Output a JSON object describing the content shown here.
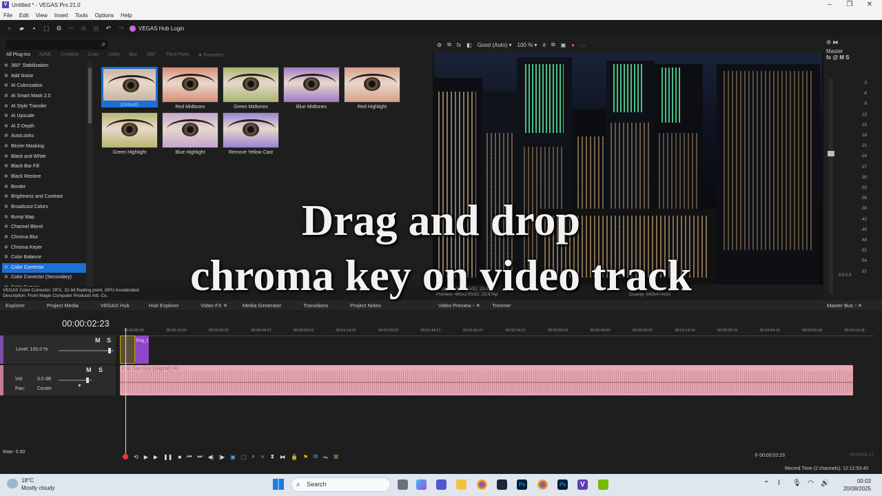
{
  "window": {
    "title": "Untitled * - VEGAS Pro 21.0"
  },
  "menu": [
    "File",
    "Edit",
    "View",
    "Insert",
    "Tools",
    "Options",
    "Help"
  ],
  "toolbar": {
    "hub_login": "VEGAS Hub Login"
  },
  "fx": {
    "tabs": [
      "All Plug-ins",
      "AI/ML",
      "Creative",
      "Color",
      "Utility",
      "Blur",
      "360°",
      "Third Party",
      "Favorites"
    ],
    "plugins": [
      "360° Stabilization",
      "Add Noise",
      "AI Colorization",
      "AI Smart Mask 2.0",
      "AI Style Transfer",
      "AI Upscale",
      "AI Z-Depth",
      "AutoLooks",
      "Bézier Masking",
      "Black and White",
      "Black Bar Fill",
      "Black Restore",
      "Border",
      "Brightness and Contrast",
      "Broadcast Colors",
      "Bump Map",
      "Channel Blend",
      "Chroma Blur",
      "Chroma Keyer",
      "Color Balance",
      "Color Corrector",
      "Color Corrector (Secondary)",
      "Color Curves"
    ],
    "selected_plugin": "Color Corrector",
    "presets": [
      "(Default)",
      "Red Midtones",
      "Green Midtones",
      "Blue Midtones",
      "Red Highlight",
      "Green Highlight",
      "Blue Highlight",
      "Remove Yellow Cast"
    ],
    "status_line1": "VEGAS Color Corrector: OFX, 32-bit floating point, GPU Accelerated",
    "status_line2": "Description: From Magix Computer Products Intl. Co."
  },
  "preview": {
    "quality": "Good (Auto)",
    "zoom": "100 %",
    "info1": "Project: 480x270x32, 23.976p",
    "info2": "Preview: 480x270x32, 23.976p",
    "display": "Display: 843x474x32"
  },
  "master": {
    "title": "Master",
    "fx": "fx",
    "m": "M",
    "s": "S",
    "scale": [
      "-3",
      "-6",
      "-9",
      "-12",
      "-15",
      "-18",
      "-21",
      "-24",
      "-27",
      "-30",
      "-33",
      "-36",
      "-39",
      "-42",
      "-45",
      "-48",
      "-51",
      "-54",
      "-57"
    ],
    "vals": "0.0  0.0"
  },
  "tabs": {
    "explorer": "Explorer",
    "project_media": "Project Media",
    "vegas_hub": "VEGAS Hub",
    "hub_explorer": "Hub Explorer",
    "video_fx": "Video FX",
    "media_generator": "Media Generator",
    "transitions": "Transitions",
    "project_notes": "Project Notes",
    "video_preview": "Video Preview",
    "trimmer": "Trimmer",
    "master_bus": "Master Bus"
  },
  "timeline": {
    "timecode": "00:00:02:23",
    "ruler": [
      "00:00:00:00",
      "00:00:15:00",
      "00:00:29:23",
      "00:00:44:23",
      "00:00:59:23",
      "00:01:14:22",
      "00:01:29:22",
      "00:01:44:21",
      "00:01:59:21",
      "00:02:14:21",
      "00:02:29:20",
      "00:02:44:20",
      "00:02:59:20",
      "00:03:14:19",
      "00:03:29:19",
      "00:03:44:19",
      "00:03:59:18",
      "00:04:14:18"
    ],
    "video_track": {
      "level": "Level: 100.0 %",
      "m": "M",
      "s": "S"
    },
    "audio_track": {
      "vol_label": "Vol:",
      "vol": "0.0 dB",
      "pan_label": "Pan:",
      "pan": "Center",
      "m": "M",
      "s": "S"
    },
    "audio_clip": "Epic Sax Guy [original] HD",
    "clip2": "Eng_1",
    "rate": "Rate: 0.00",
    "cursor_time": "00:00:02:23",
    "end_time": "00:00:01:17"
  },
  "status": {
    "record_time": "Record Time (2 channels): 12:12:53:40"
  },
  "overlay": {
    "line1": "Drag and drop",
    "line2": "chroma key on video track"
  },
  "taskbar": {
    "temp": "18°C",
    "weather": "Mostly cloudy",
    "search": "Search",
    "time": "00:03",
    "date": "20/08/2025"
  }
}
